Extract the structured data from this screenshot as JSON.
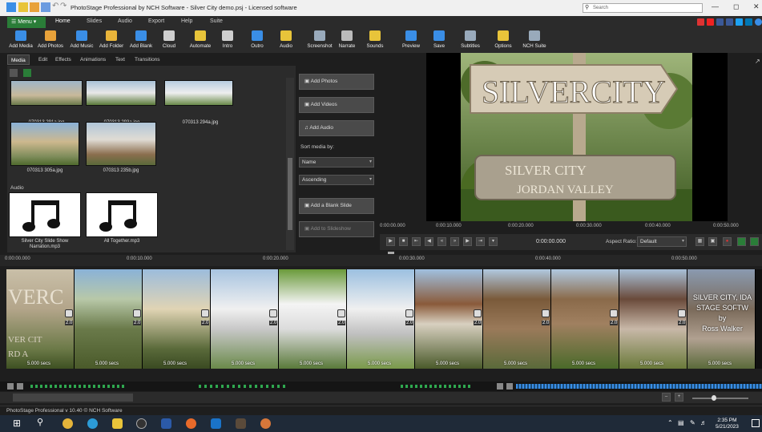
{
  "window": {
    "title": "PhotoStage Professional by NCH Software - Silver City demo.psj - Licensed software",
    "search_placeholder": "Search"
  },
  "menubar": {
    "menu_button": "Menu",
    "tabs": [
      "Home",
      "Slides",
      "Audio",
      "Export",
      "Help",
      "Suite"
    ]
  },
  "toolbar": {
    "buttons": [
      {
        "label": "Add Media",
        "icon": "add-media-icon",
        "color": "#3a8ee6"
      },
      {
        "label": "Add Photos",
        "icon": "add-photos-icon",
        "color": "#e8a23a"
      },
      {
        "label": "Add Music",
        "icon": "add-music-icon",
        "color": "#3a8ee6"
      },
      {
        "label": "Add Folder",
        "icon": "add-folder-icon",
        "color": "#e8b43a"
      },
      {
        "label": "Add Blank",
        "icon": "add-blank-icon",
        "color": "#3a8ee6"
      },
      {
        "label": "Cloud",
        "icon": "cloud-icon",
        "color": "#cfcfcf"
      },
      {
        "label": "Automate",
        "icon": "automate-icon",
        "color": "#e8c43a"
      },
      {
        "label": "Intro",
        "icon": "intro-icon",
        "color": "#cfcfcf"
      },
      {
        "label": "Outro",
        "icon": "outro-icon",
        "color": "#3a8ee6"
      },
      {
        "label": "Audio",
        "icon": "audio-icon",
        "color": "#e8c43a"
      },
      {
        "label": "Screenshot",
        "icon": "screenshot-icon",
        "color": "#9ab"
      },
      {
        "label": "Narrate",
        "icon": "narrate-icon",
        "color": "#bbb"
      },
      {
        "label": "Sounds",
        "icon": "sounds-icon",
        "color": "#e8c43a"
      },
      {
        "label": "Preview",
        "icon": "preview-icon",
        "color": "#3a8ee6"
      },
      {
        "label": "Save",
        "icon": "save-icon",
        "color": "#3a8ee6"
      },
      {
        "label": "Subtitles",
        "icon": "subtitles-icon",
        "color": "#9ab"
      },
      {
        "label": "Options",
        "icon": "options-icon",
        "color": "#e8c43a"
      },
      {
        "label": "NCH Suite",
        "icon": "nch-suite-icon",
        "color": "#9ab"
      }
    ]
  },
  "panel_tabs": [
    "Media",
    "Edit",
    "Effects",
    "Animations",
    "Text",
    "Transitions"
  ],
  "media": {
    "photos": [
      {
        "caption": "070313 291a.jpg"
      },
      {
        "caption": "070313 293a.jpg"
      },
      {
        "caption": "070313 294a.jpg"
      },
      {
        "caption": "070313 305a.jpg"
      },
      {
        "caption": "070313 235b.jpg"
      }
    ],
    "audio_heading": "Audio",
    "audio": [
      {
        "caption": "Silver City Slide Show Narration.mp3"
      },
      {
        "caption": "All Together.mp3"
      }
    ]
  },
  "side": {
    "add_photos": "Add Photos",
    "add_videos": "Add Videos",
    "add_audio": "Add Audio",
    "sort_label": "Sort media by:",
    "sort_value": "Name",
    "order_value": "Ascending",
    "add_blank_slide": "Add a Blank Slide",
    "add_to_slideshow": "Add to Slideshow"
  },
  "preview": {
    "sign_top": "SILVERCITY",
    "sign_bottom_1": "SILVER CITY",
    "sign_bottom_2": "JORDAN VALLEY",
    "ruler": [
      "0:00:00.000",
      "0:00:10.000",
      "0:00:20.000",
      "0:00:30.000",
      "0:00:40.000",
      "0:00:50.000"
    ],
    "time": "0:00:00.000",
    "aspect_label": "Aspect Ratio:",
    "aspect_value": "Default"
  },
  "timeline": {
    "ruler": [
      "0:00:00.000",
      "0:00:10.000",
      "0:00:20.000",
      "0:00:30.000",
      "0:00:40.000",
      "0:00:50.000"
    ],
    "slides": [
      {
        "duration": "5.000 secs",
        "transition": "2.0"
      },
      {
        "duration": "5.000 secs",
        "transition": "2.0"
      },
      {
        "duration": "5.000 secs",
        "transition": "2.0"
      },
      {
        "duration": "5.000 secs",
        "transition": "2.0"
      },
      {
        "duration": "5.000 secs",
        "transition": "2.0"
      },
      {
        "duration": "5.000 secs",
        "transition": "2.0"
      },
      {
        "duration": "5.000 secs",
        "transition": "2.0"
      },
      {
        "duration": "5.000 secs",
        "transition": "2.0"
      },
      {
        "duration": "5.000 secs",
        "transition": "2.0"
      },
      {
        "duration": "5.000 secs",
        "transition": "2.0"
      },
      {
        "duration": "5.000 secs",
        "transition": ""
      }
    ],
    "first_slide_text_1": "VERC",
    "first_slide_text_2": "VER CIT",
    "first_slide_text_3": "RD A",
    "last_slide_text": [
      "SILVER CITY, IDA",
      "STAGE SOFTW",
      "by",
      "Ross Walker"
    ]
  },
  "status": {
    "text": "PhotoStage Professional v 10.40 © NCH Software"
  },
  "taskbar": {
    "time": "2:35 PM",
    "date": "5/21/2023"
  }
}
